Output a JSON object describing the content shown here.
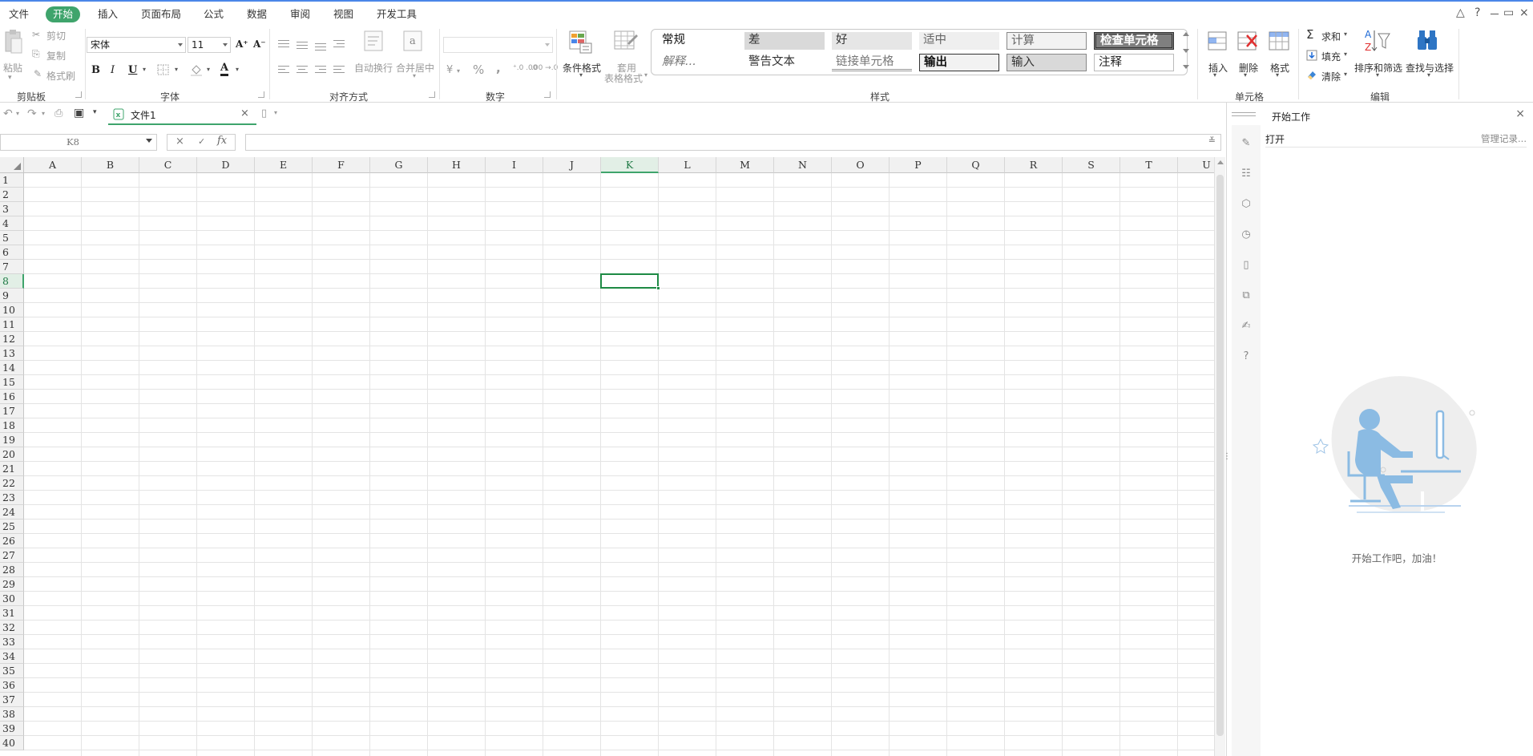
{
  "menu": {
    "items": [
      "文件",
      "开始",
      "插入",
      "页面布局",
      "公式",
      "数据",
      "审阅",
      "视图",
      "开发工具"
    ],
    "active": "开始"
  },
  "window_controls": {
    "up": "△",
    "help": "?",
    "min": "－",
    "restore": "▭",
    "close": "×"
  },
  "ribbon": {
    "clipboard": {
      "paste": "粘贴",
      "cut": "剪切",
      "copy": "复制",
      "format_painter": "格式刷",
      "label": "剪贴板"
    },
    "font": {
      "name": "宋体",
      "size": "11",
      "grow": "A⁺",
      "shrink": "A⁻",
      "bold": "B",
      "italic": "I",
      "underline": "U",
      "color_letter": "A",
      "label": "字体"
    },
    "alignment": {
      "wrap": "自动换行",
      "merge": "合并居中",
      "label": "对齐方式"
    },
    "number": {
      "format": "",
      "percent": "%",
      "comma": ",",
      "label": "数字"
    },
    "styles": {
      "conditional": "条件格式",
      "table_format_1": "套用",
      "table_format_2": "表格格式",
      "label": "样式",
      "gallery": [
        "常规",
        "差",
        "好",
        "适中",
        "计算",
        "检查单元格",
        "解释...",
        "警告文本",
        "链接单元格",
        "输出",
        "输入",
        "注释"
      ]
    },
    "cells": {
      "insert": "插入",
      "delete": "删除",
      "format": "格式",
      "label": "单元格"
    },
    "editing": {
      "sum": "求和",
      "fill": "填充",
      "clear": "清除",
      "sort": "排序和筛选",
      "find": "查找与选择",
      "label": "编辑"
    }
  },
  "quick_access": {
    "doc_tab": "文件1"
  },
  "formula_bar": {
    "name_box": "K8",
    "cancel": "×",
    "enter": "✓",
    "fx": "fx",
    "value": ""
  },
  "sheet": {
    "columns": [
      "A",
      "B",
      "C",
      "D",
      "E",
      "F",
      "G",
      "H",
      "I",
      "J",
      "K",
      "L",
      "M",
      "N",
      "O",
      "P",
      "Q",
      "R",
      "S",
      "T",
      "U"
    ],
    "rows": [
      "1",
      "2",
      "3",
      "4",
      "5",
      "6",
      "7",
      "8",
      "9",
      "10",
      "11",
      "12",
      "13",
      "14",
      "15",
      "16",
      "17",
      "18",
      "19",
      "20",
      "21",
      "22",
      "23",
      "24",
      "25",
      "26",
      "27",
      "28",
      "29",
      "30",
      "31",
      "32",
      "33",
      "34",
      "35",
      "36",
      "37",
      "38",
      "39",
      "40"
    ],
    "active_cell": "K8"
  },
  "side_panel": {
    "title": "开始工作",
    "open": "打开",
    "manage": "管理记录...",
    "empty_message": "开始工作吧，加油！"
  },
  "colors": {
    "accent": "#3fa46c",
    "active_cell": "#1e8a45",
    "illustration": "#8bbbe3"
  }
}
